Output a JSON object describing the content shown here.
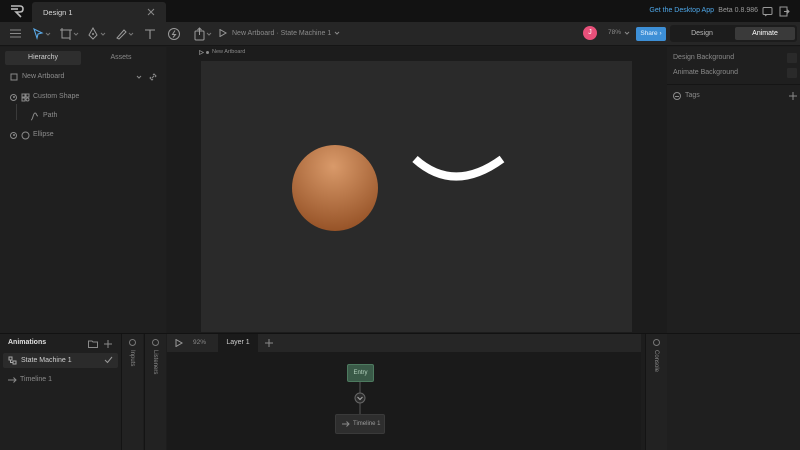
{
  "app": {
    "document_tab": "Design 1",
    "desktop_link": "Get the Desktop App",
    "version": "Beta 0.8.986"
  },
  "toolbar": {
    "breadcrumb": "New Artboard · State Machine 1",
    "avatar_initial": "J",
    "zoom": "78%",
    "share_label": "Share",
    "modes": {
      "design": "Design",
      "animate": "Animate",
      "active": "Animate"
    }
  },
  "left_panel": {
    "tabs": [
      "Hierarchy",
      "Assets"
    ],
    "active_tab": "Hierarchy",
    "tree": {
      "artboard": "New Artboard",
      "items": [
        {
          "label": "Custom Shape",
          "icon": "custom-shape-icon",
          "children": [
            {
              "label": "Path",
              "icon": "path-icon"
            }
          ]
        },
        {
          "label": "Ellipse",
          "icon": "ellipse-icon",
          "children": []
        }
      ]
    }
  },
  "stage": {
    "artboard_label": "New Artboard",
    "colors": {
      "ball_light": "#d99a6a",
      "ball_dark": "#8e4a1f",
      "smile": "#ffffff",
      "artboard": "#2a2a2a"
    }
  },
  "right_panel": {
    "design_background": "Design Background",
    "animate_background": "Animate Background",
    "tags": "Tags"
  },
  "animations": {
    "title": "Animations",
    "items": [
      {
        "label": "State Machine 1",
        "icon": "state-machine-icon",
        "selected": true
      },
      {
        "label": "Timeline 1",
        "icon": "timeline-icon",
        "selected": false
      }
    ]
  },
  "strips": {
    "inputs": "Inputs",
    "listeners": "Listeners",
    "console": "Console"
  },
  "graph": {
    "zoom": "92%",
    "layer_tab": "Layer 1",
    "entry_node": "Entry",
    "timeline_node": "Timeline 1"
  },
  "colors": {
    "accent": "#3d8fd6",
    "link": "#4ea7e8",
    "avatar": "#e8507a",
    "entry_node": "#3a5a48"
  }
}
